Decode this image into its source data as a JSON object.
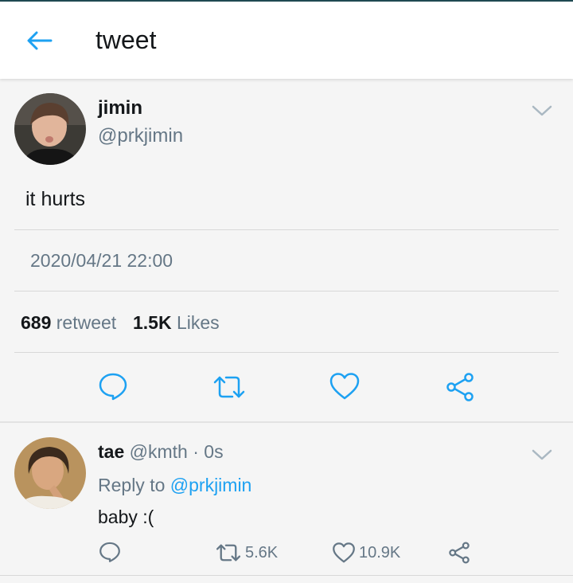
{
  "header": {
    "title": "tweet",
    "back_icon": "arrow-left-icon",
    "accent": "#1da1f2"
  },
  "tweet": {
    "name": "jimin",
    "handle": "@prkjimin",
    "text": "it hurts",
    "timestamp": "2020/04/21 22:00",
    "retweet_count": "689",
    "retweet_label": "retweet",
    "like_count": "1.5K",
    "like_label": "Likes",
    "actions": [
      "reply-icon",
      "retweet-icon",
      "heart-icon",
      "share-icon"
    ]
  },
  "reply": {
    "name": "tae",
    "handle": "@kmth",
    "time": "· 0s",
    "reply_prefix": "Reply to",
    "reply_to": "@prkjimin",
    "text": "baby :(",
    "retweet_count": "5.6K",
    "like_count": "10.9K"
  }
}
